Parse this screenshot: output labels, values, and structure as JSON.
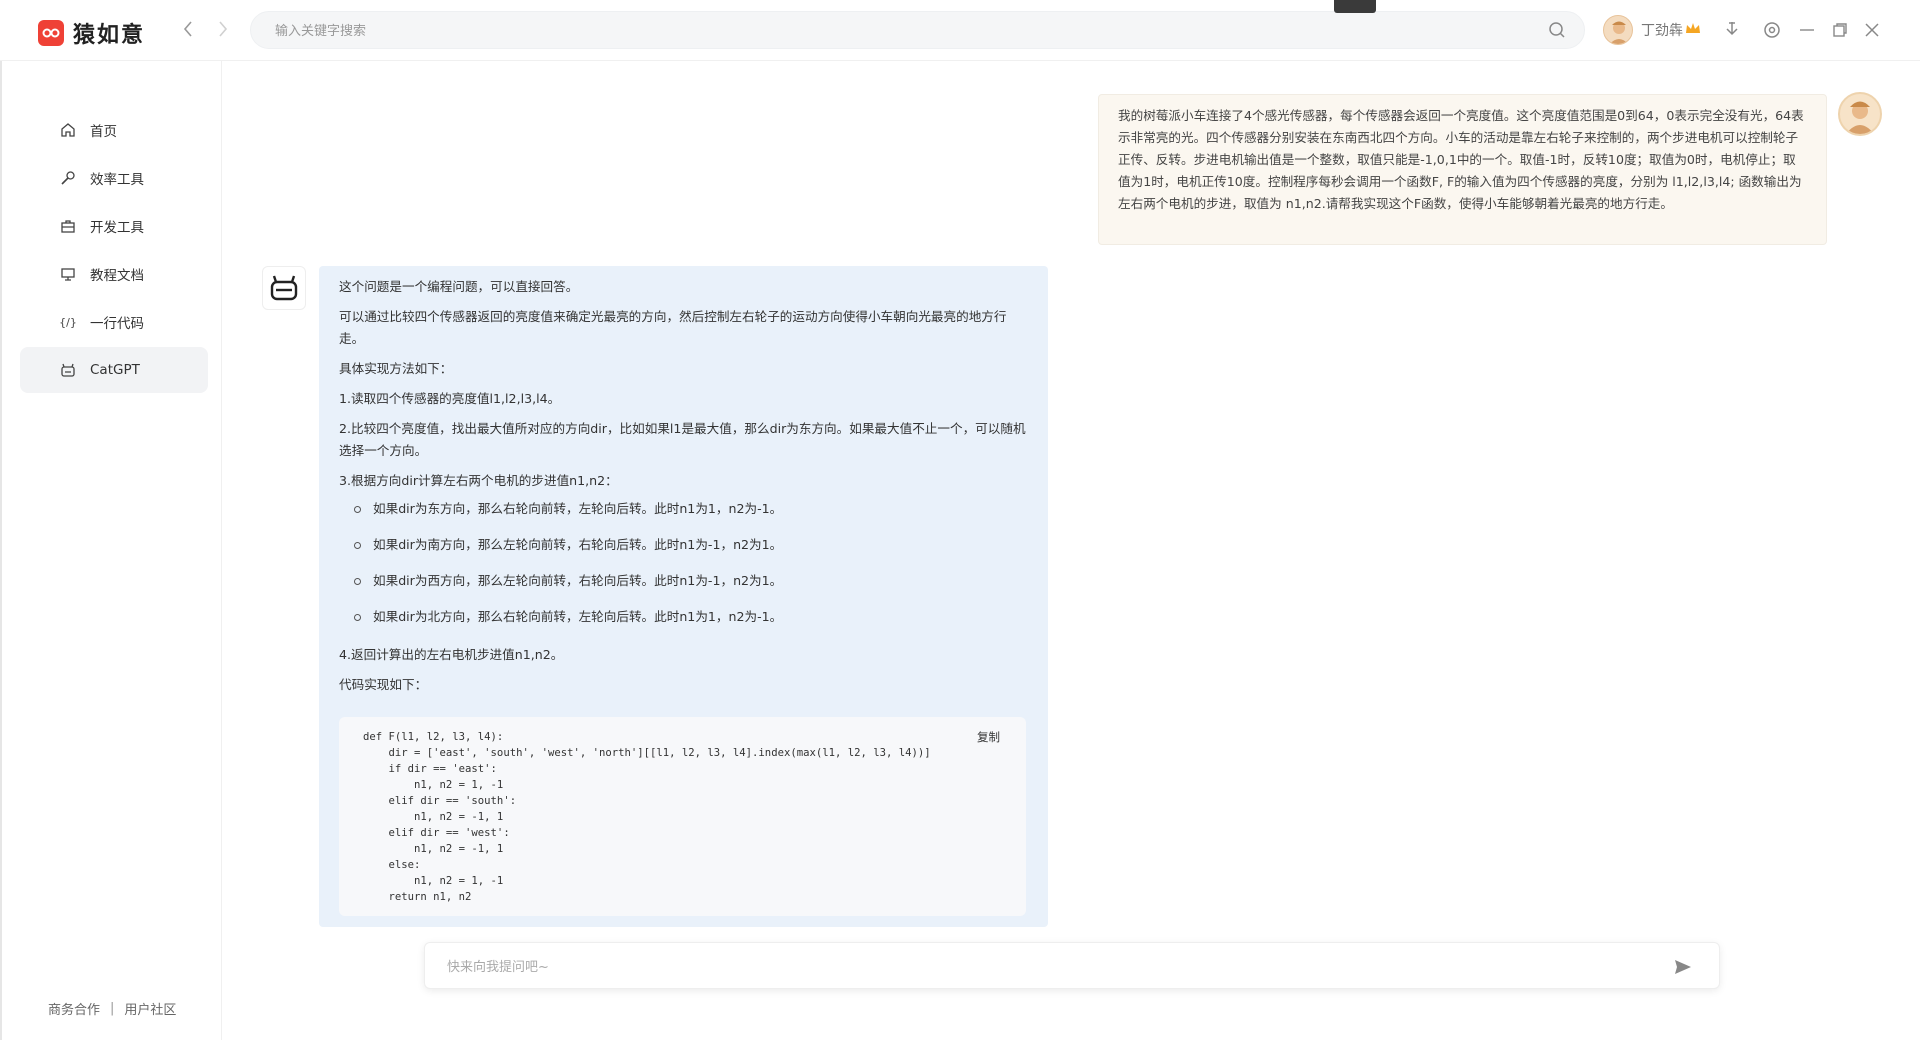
{
  "app": {
    "name": "猿如意",
    "brand_color": "#ef4136"
  },
  "search": {
    "placeholder": "输入关键字搜索"
  },
  "user": {
    "name": "丁劲犇"
  },
  "sidebar": {
    "items": [
      {
        "label": "首页",
        "icon": "home-icon"
      },
      {
        "label": "效率工具",
        "icon": "wrench-icon"
      },
      {
        "label": "开发工具",
        "icon": "toolbox-icon"
      },
      {
        "label": "教程文档",
        "icon": "monitor-icon"
      },
      {
        "label": "一行代码",
        "icon": "code-icon",
        "icon_text": "{/}"
      },
      {
        "label": "CatGPT",
        "icon": "robot-icon",
        "active": true
      }
    ],
    "footer": {
      "business": "商务合作",
      "separator": "|",
      "community": "用户社区"
    }
  },
  "chat": {
    "user_message": "我的树莓派小车连接了4个感光传感器，每个传感器会返回一个亮度值。这个亮度值范围是0到64，0表示完全没有光，64表示非常亮的光。四个传感器分别安装在东南西北四个方向。小车的活动是靠左右轮子来控制的，两个步进电机可以控制轮子正传、反转。步进电机输出值是一个整数，取值只能是-1,0,1中的一个。取值-1时，反转10度；取值为0时，电机停止；取值为1时，电机正传10度。控制程序每秒会调用一个函数F, F的输入值为四个传感器的亮度，分别为 l1,l2,l3,l4; 函数输出为左右两个电机的步进，取值为 n1,n2.请帮我实现这个F函数，使得小车能够朝着光最亮的地方行走。",
    "bot": {
      "intro": "这个问题是一个编程问题，可以直接回答。",
      "approach": "可以通过比较四个传感器返回的亮度值来确定光最亮的方向，然后控制左右轮子的运动方向使得小车朝向光最亮的地方行走。",
      "method_title": "具体实现方法如下：",
      "step1": "1.读取四个传感器的亮度值l1,l2,l3,l4。",
      "step2": "2.比较四个亮度值，找出最大值所对应的方向dir，比如如果l1是最大值，那么dir为东方向。如果最大值不止一个，可以随机选择一个方向。",
      "step3": "3.根据方向dir计算左右两个电机的步进值n1,n2：",
      "bullets": [
        "如果dir为东方向，那么右轮向前转，左轮向后转。此时n1为1，n2为-1。",
        "如果dir为南方向，那么左轮向前转，右轮向后转。此时n1为-1，n2为1。",
        "如果dir为西方向，那么左轮向前转，右轮向后转。此时n1为-1，n2为1。",
        "如果dir为北方向，那么右轮向前转，左轮向后转。此时n1为1，n2为-1。"
      ],
      "step4": "4.返回计算出的左右电机步进值n1,n2。",
      "code_title": "代码实现如下：",
      "copy_label": "复制",
      "code_lines": [
        "def F(l1, l2, l3, l4):",
        "    dir = ['east', 'south', 'west', 'north'][[l1, l2, l3, l4].index(max(l1, l2, l3, l4))]",
        "    if dir == 'east':",
        "        n1, n2 = 1, -1",
        "    elif dir == 'south':",
        "        n1, n2 = -1, 1",
        "    elif dir == 'west':",
        "        n1, n2 = -1, 1",
        "    else:",
        "        n1, n2 = 1, -1",
        "    return n1, n2"
      ]
    },
    "input": {
      "placeholder": "快来向我提问吧~"
    }
  }
}
